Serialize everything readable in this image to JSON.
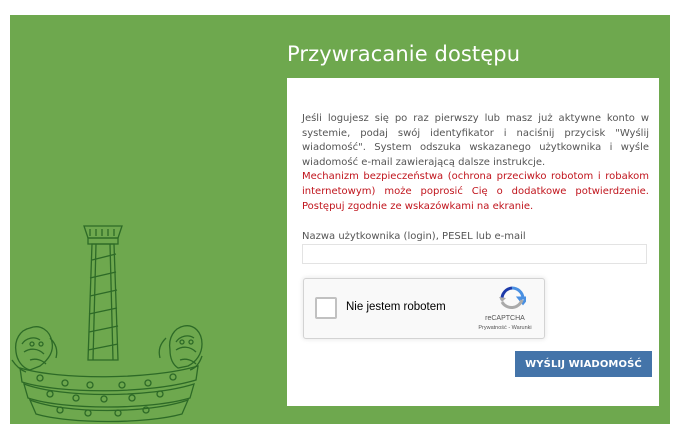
{
  "page": {
    "title": "Przywracanie dostępu",
    "background_color": "#6ea84e",
    "emblem_icon": "city-crest-column-lions-icon"
  },
  "card": {
    "intro_text": "Jeśli logujesz się po raz pierwszy lub masz już aktywne konto w systemie, podaj swój identyfikator i naciśnij przycisk \"Wyślij wiadomość\". System odszuka wskazanego użytkownika i wyśle wiadomość e-mail zawierającą dalsze instrukcje.",
    "warning_text": "Mechanizm bezpieczeństwa (ochrona przeciwko robotom i robakom internetowym) może poprosić Cię o dodatkowe potwierdzenie. Postępuj zgodnie ze wskazówkami na ekranie.",
    "warning_color": "#c0141c",
    "field_label": "Nazwa użytkownika (login), PESEL lub e-mail",
    "field_value": "",
    "field_placeholder": ""
  },
  "recaptcha": {
    "label": "Nie jestem robotem",
    "brand": "reCAPTCHA",
    "links": "Prywatność - Warunki",
    "logo_icon": "recaptcha-logo-icon"
  },
  "submit": {
    "label": "WYŚLIJ WIADOMOŚĆ",
    "color": "#4474a9"
  }
}
